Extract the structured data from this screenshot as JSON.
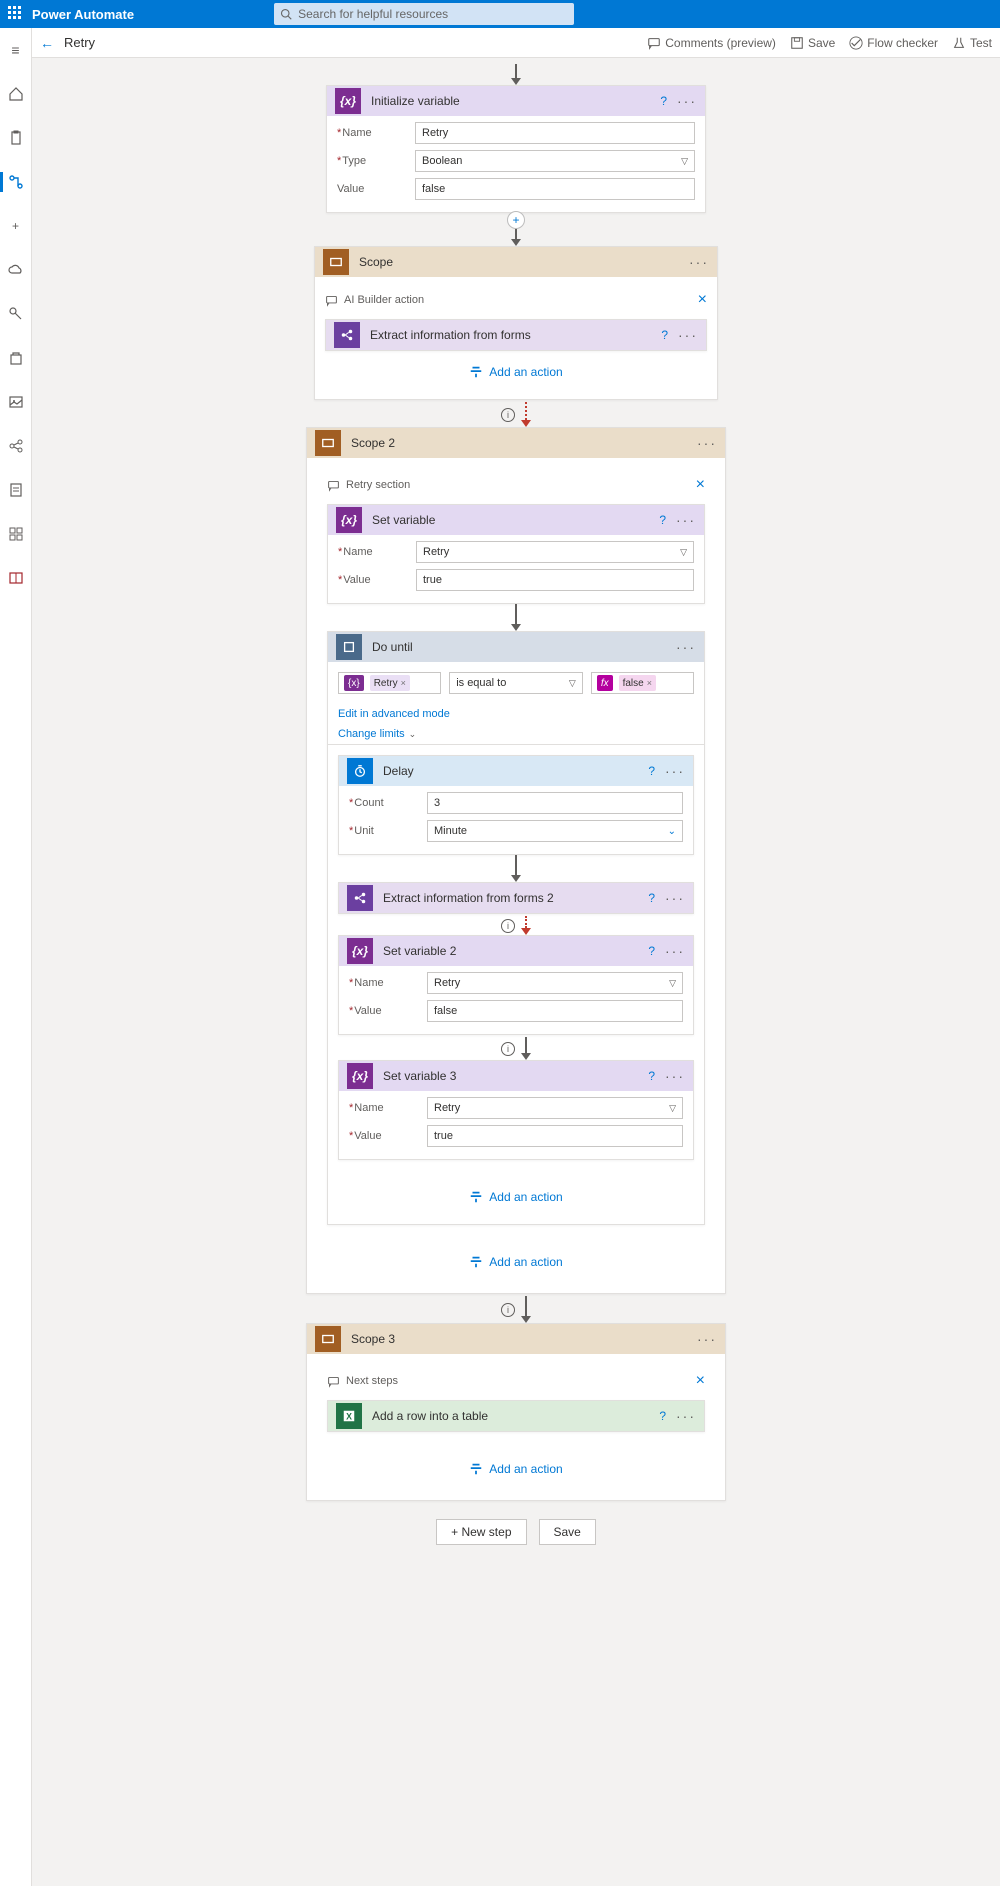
{
  "header": {
    "app_title": "Power Automate",
    "search_placeholder": "Search for helpful resources"
  },
  "subheader": {
    "title": "Retry",
    "actions": {
      "comments": "Comments (preview)",
      "save": "Save",
      "checker": "Flow checker",
      "test": "Test"
    }
  },
  "init_var": {
    "title": "Initialize variable",
    "name_label": "Name",
    "name_value": "Retry",
    "type_label": "Type",
    "type_value": "Boolean",
    "value_label": "Value",
    "value_value": "false"
  },
  "scope1": {
    "title": "Scope",
    "comment": "AI Builder action",
    "extract_title": "Extract information from forms",
    "add_action": "Add an action"
  },
  "scope2": {
    "title": "Scope 2",
    "comment": "Retry section",
    "set_var": {
      "title": "Set variable",
      "name_label": "Name",
      "name_value": "Retry",
      "value_label": "Value",
      "value_value": "true"
    },
    "do_until": {
      "title": "Do until",
      "left_token": "Retry",
      "operator": "is equal to",
      "right_token": "false",
      "edit_link": "Edit in advanced mode",
      "limits_link": "Change limits"
    },
    "delay": {
      "title": "Delay",
      "count_label": "Count",
      "count_value": "3",
      "unit_label": "Unit",
      "unit_value": "Minute"
    },
    "extract2_title": "Extract information from forms 2",
    "set_var2": {
      "title": "Set variable 2",
      "name_label": "Name",
      "name_value": "Retry",
      "value_label": "Value",
      "value_value": "false"
    },
    "set_var3": {
      "title": "Set variable 3",
      "name_label": "Name",
      "name_value": "Retry",
      "value_label": "Value",
      "value_value": "true"
    },
    "add_action_inner": "Add an action",
    "add_action_outer": "Add an action"
  },
  "scope3": {
    "title": "Scope 3",
    "comment": "Next steps",
    "add_row_title": "Add a row into a table",
    "add_action": "Add an action"
  },
  "bottom": {
    "new_step": "+ New step",
    "save": "Save"
  }
}
